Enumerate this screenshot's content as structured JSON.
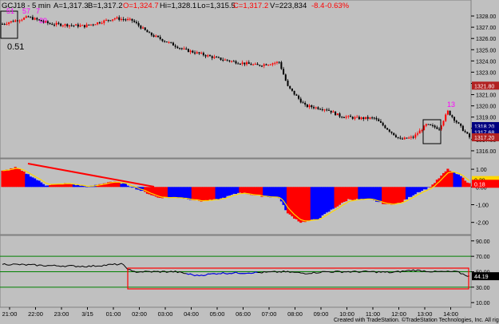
{
  "header": {
    "symbol": "GCJ18 - 5 min",
    "ask": "A=1,317.3",
    "bid": "B=1,317.2",
    "open": "O=1,324.7",
    "high": "Hi=1,328.1",
    "low": "Lo=1,315.5",
    "close": "C=1,317.2",
    "volume": "V=223,834",
    "change": "-8.4",
    "change_pct": "-0.63%"
  },
  "overlay_label": "0.51",
  "price_axis": {
    "ticks": [
      "1328.00",
      "1327.00",
      "1326.00",
      "1325.00",
      "1324.00",
      "1323.00",
      "1322.00",
      "1321.00",
      "1320.00",
      "1319.00",
      "1318.00",
      "1317.00",
      "1316.00"
    ],
    "tags": [
      {
        "label": "1321.80",
        "value": 1321.8,
        "color": "#b22222"
      },
      {
        "label": "1318.20",
        "value": 1318.2,
        "color": "#000080"
      },
      {
        "label": "1317.68",
        "value": 1317.68,
        "color": "#000080"
      },
      {
        "label": "1317.20",
        "value": 1317.2,
        "color": "#b22222"
      }
    ]
  },
  "osc_axis": {
    "ticks": [
      "1.00",
      "0.00",
      "-1.00",
      "-2.00"
    ],
    "tags": [
      {
        "label": "0.39",
        "value": 0.39,
        "color": "#ffd700",
        "text": "#000"
      },
      {
        "label": "0.18",
        "value": 0.18,
        "color": "#ff0000",
        "text": "#fff"
      }
    ]
  },
  "rsi_axis": {
    "ticks": [
      "90.00",
      "70.00",
      "50.00",
      "30.00",
      "10.00"
    ],
    "tag": {
      "label": "44.19",
      "value": 44.19
    }
  },
  "time_axis": [
    "21:00",
    "22:00",
    "23:00",
    "3/15",
    "01:00",
    "02:00",
    "03:00",
    "04:00",
    "05:00",
    "06:00",
    "07:00",
    "08:00",
    "09:00",
    "10:00",
    "11:00",
    "12:00",
    "13:00",
    "14:00"
  ],
  "annotations": {
    "pink_top_left": [
      "51",
      "57",
      "7"
    ],
    "pink_left_low": "89",
    "pink_right": "13"
  },
  "footer": "Created with TradeStation. ©TradeStation Technologies, Inc. All rights reserved.",
  "colors": {
    "background": "#c0c0c0",
    "up": "#ff0000",
    "down": "#000000",
    "osc_pos_red": "#ff0000",
    "osc_blue": "#0000ff",
    "signal": "#ffd700",
    "rsi_line": "#000000",
    "rsi_low": "#0000ff",
    "level_line": "#008000",
    "annotation_pink": "#ff00ff"
  },
  "chart_data": [
    {
      "type": "candlestick",
      "x_range": [
        "21:00",
        "14:30"
      ],
      "ylim": [
        1315.5,
        1328.5
      ],
      "waypoints": [
        [
          0,
          1327.3
        ],
        [
          12,
          1327.9
        ],
        [
          22,
          1327.3
        ],
        [
          38,
          1327.1
        ],
        [
          52,
          1327.8
        ],
        [
          60,
          1327.6
        ],
        [
          68,
          1326.4
        ],
        [
          84,
          1325.0
        ],
        [
          100,
          1324.2
        ],
        [
          108,
          1323.9
        ],
        [
          118,
          1323.6
        ],
        [
          128,
          1323.9
        ],
        [
          132,
          1321.7
        ],
        [
          140,
          1320.0
        ],
        [
          150,
          1319.7
        ],
        [
          156,
          1319.1
        ],
        [
          164,
          1318.9
        ],
        [
          172,
          1318.9
        ],
        [
          184,
          1317.0
        ],
        [
          190,
          1317.2
        ],
        [
          196,
          1318.3
        ],
        [
          202,
          1318.0
        ],
        [
          206,
          1319.5
        ],
        [
          212,
          1318.1
        ],
        [
          216,
          1317.2
        ]
      ],
      "n_bars": 217
    },
    {
      "type": "histogram",
      "ylim": [
        -2.6,
        1.5
      ],
      "signal_current": 0.39,
      "hist_current": 0.18,
      "waypoints": [
        [
          0,
          0.9
        ],
        [
          6,
          1.1
        ],
        [
          12,
          0.7
        ],
        [
          20,
          0.1
        ],
        [
          30,
          0.2
        ],
        [
          40,
          0.0
        ],
        [
          50,
          0.3
        ],
        [
          56,
          0.2
        ],
        [
          62,
          -0.1
        ],
        [
          72,
          -0.6
        ],
        [
          82,
          -0.6
        ],
        [
          92,
          -0.8
        ],
        [
          100,
          -0.7
        ],
        [
          110,
          -0.3
        ],
        [
          118,
          -0.5
        ],
        [
          128,
          -0.6
        ],
        [
          132,
          -1.5
        ],
        [
          138,
          -2.0
        ],
        [
          146,
          -1.8
        ],
        [
          152,
          -1.3
        ],
        [
          160,
          -0.7
        ],
        [
          170,
          -0.7
        ],
        [
          178,
          -1.0
        ],
        [
          184,
          -0.9
        ],
        [
          192,
          -0.3
        ],
        [
          198,
          0.0
        ],
        [
          206,
          1.0
        ],
        [
          212,
          0.6
        ],
        [
          216,
          0.18
        ]
      ]
    },
    {
      "type": "line",
      "ylim": [
        5,
        95
      ],
      "levels": [
        70,
        50,
        30
      ],
      "current": 44.19,
      "waypoints": [
        [
          0,
          60
        ],
        [
          20,
          58
        ],
        [
          40,
          57
        ],
        [
          55,
          60
        ],
        [
          60,
          50
        ],
        [
          80,
          50
        ],
        [
          90,
          45
        ],
        [
          100,
          48
        ],
        [
          120,
          49
        ],
        [
          130,
          50
        ],
        [
          140,
          48
        ],
        [
          150,
          50
        ],
        [
          170,
          50
        ],
        [
          180,
          49
        ],
        [
          190,
          52
        ],
        [
          200,
          50
        ],
        [
          210,
          50
        ],
        [
          216,
          44
        ]
      ]
    }
  ]
}
